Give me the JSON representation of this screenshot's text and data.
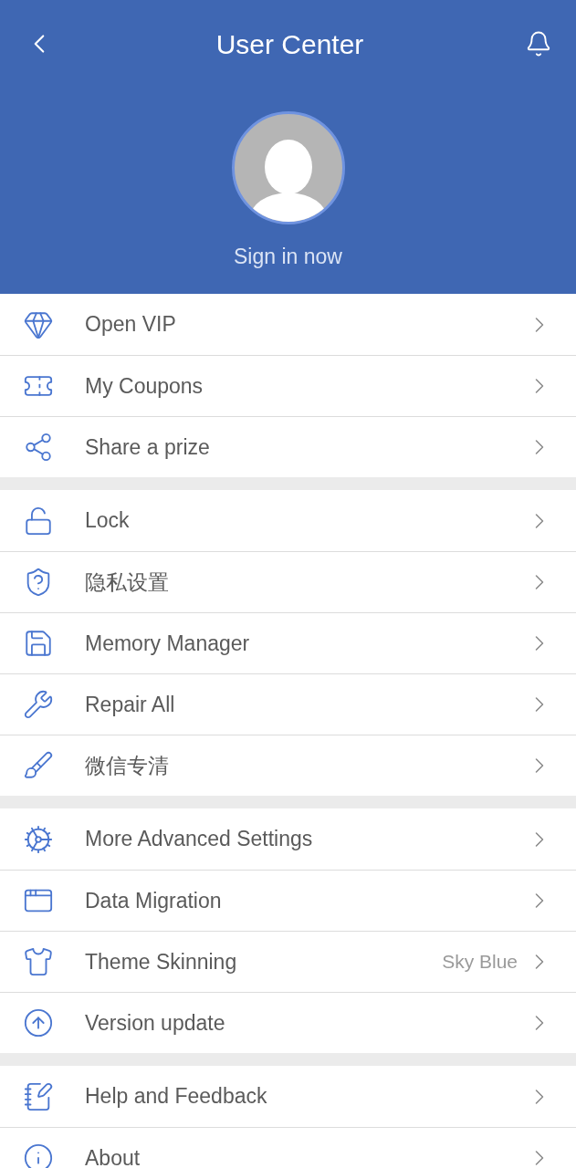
{
  "header": {
    "title": "User Center",
    "sign_in": "Sign in now"
  },
  "groups": [
    {
      "items": [
        {
          "label": "Open VIP"
        },
        {
          "label": "My Coupons"
        },
        {
          "label": "Share a prize"
        }
      ]
    },
    {
      "items": [
        {
          "label": "Lock"
        },
        {
          "label": "隐私设置"
        },
        {
          "label": "Memory Manager"
        },
        {
          "label": "Repair All"
        },
        {
          "label": "微信专清"
        }
      ]
    },
    {
      "items": [
        {
          "label": "More Advanced Settings"
        },
        {
          "label": "Data Migration"
        },
        {
          "label": "Theme Skinning",
          "value": "Sky Blue"
        },
        {
          "label": "Version update"
        }
      ]
    },
    {
      "items": [
        {
          "label": "Help and Feedback"
        },
        {
          "label": "About"
        }
      ]
    }
  ]
}
